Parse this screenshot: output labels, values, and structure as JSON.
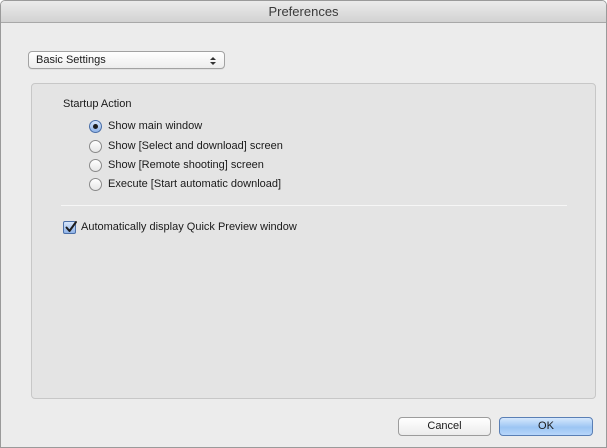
{
  "window": {
    "title": "Preferences"
  },
  "settings_popup": {
    "selected": "Basic Settings"
  },
  "startup": {
    "label": "Startup Action",
    "options": [
      {
        "label": "Show main window",
        "checked": true
      },
      {
        "label": "Show [Select and download] screen",
        "checked": false
      },
      {
        "label": "Show [Remote shooting] screen",
        "checked": false
      },
      {
        "label": "Execute [Start automatic download]",
        "checked": false
      }
    ]
  },
  "quick_preview": {
    "label": "Automatically display Quick Preview window",
    "checked": true
  },
  "buttons": {
    "cancel": "Cancel",
    "ok": "OK"
  }
}
